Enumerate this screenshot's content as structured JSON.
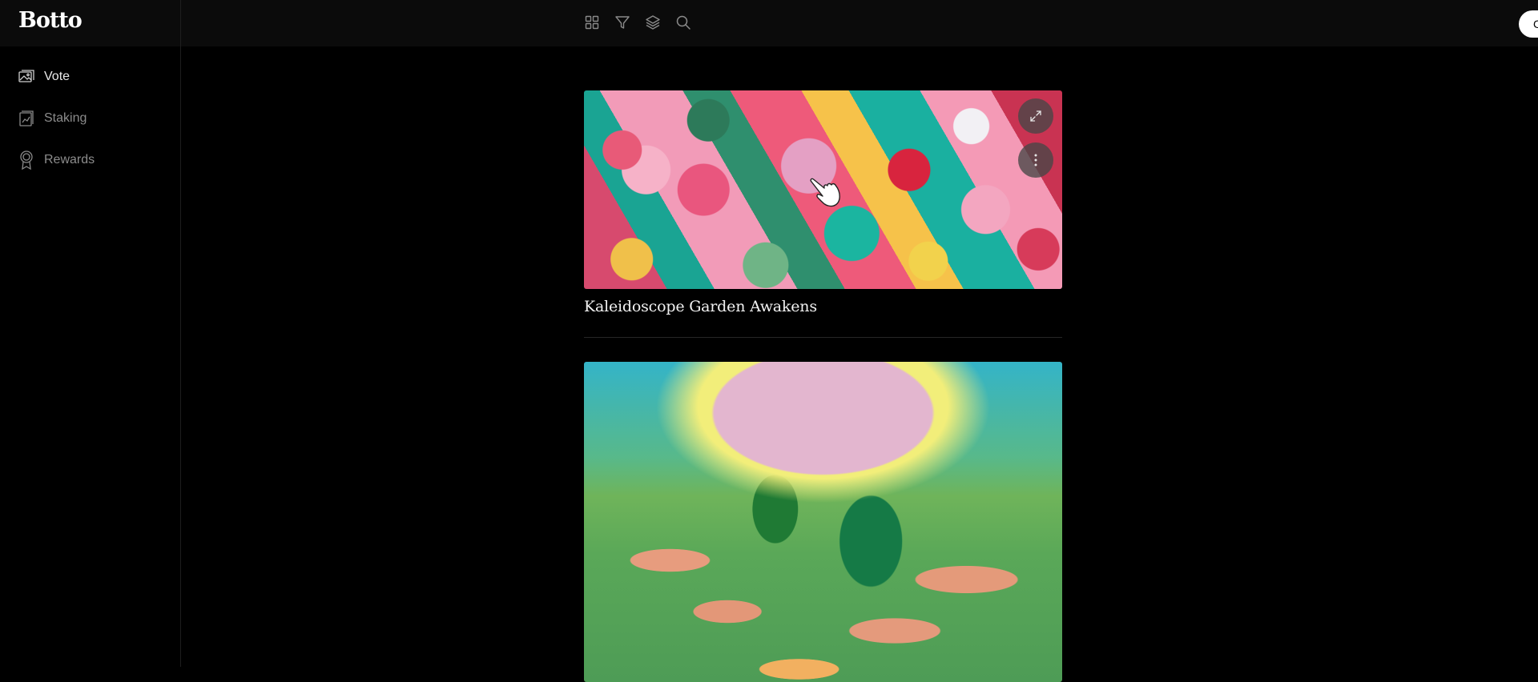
{
  "app": {
    "logo": "Botto"
  },
  "sidebar": {
    "items": [
      {
        "label": "Vote",
        "icon": "image-gallery-icon",
        "active": true
      },
      {
        "label": "Staking",
        "icon": "chart-square-icon",
        "active": false
      },
      {
        "label": "Rewards",
        "icon": "award-ribbon-icon",
        "active": false
      }
    ]
  },
  "toolbar": {
    "icons": [
      "grid-view-icon",
      "filter-icon",
      "layers-icon",
      "search-icon"
    ]
  },
  "header": {
    "connect_label": "C"
  },
  "feed": {
    "cards": [
      {
        "title": "Kaleidoscope Garden Awakens"
      },
      {
        "title": ""
      }
    ]
  },
  "colors": {
    "background": "#000000",
    "topbar": "#0b0b0b",
    "text_active": "#e8e8e8",
    "text_muted": "#8c8c8c"
  }
}
